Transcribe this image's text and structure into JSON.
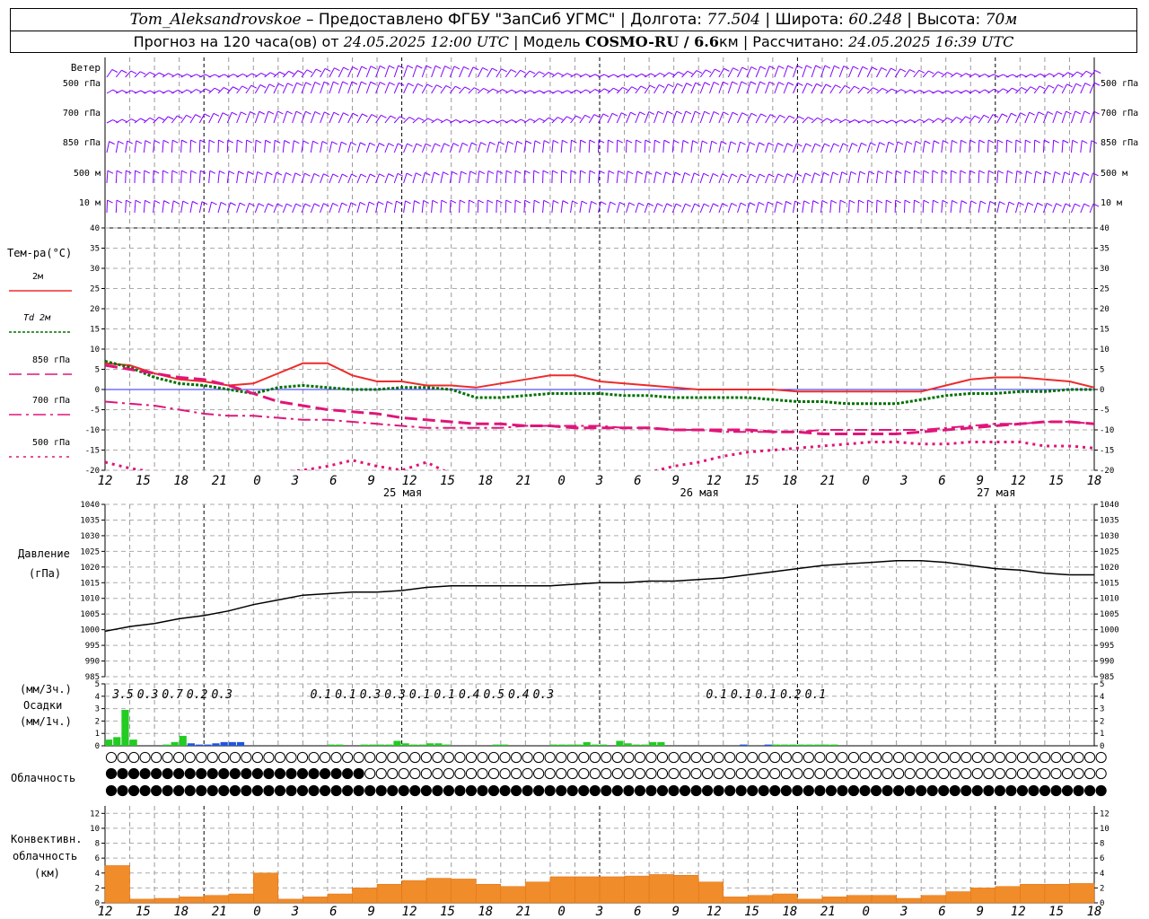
{
  "header": {
    "station": "Tom_Aleksandrovskoe",
    "provider": "– Предоставлено ФГБУ \"ЗапСиб УГМС\"",
    "lon_label": "| Долгота:",
    "lon": "77.504",
    "lat_label": "| Широта:",
    "lat": "60.248",
    "alt_label": "| Высота:",
    "alt": "70м",
    "forecast_label": "Прогноз на 120 часа(ов) от",
    "init_time": "24.05.2025 12:00 UTC",
    "model_label": "| Модель",
    "model": "COSMO-RU / 6.6",
    "model_unit": "км",
    "calc_label": "| Рассчитано:",
    "calc_time": "24.05.2025 16:39 UTC"
  },
  "wind_panel": {
    "title": "Ветер",
    "levels": [
      "500 гПа",
      "700 гПа",
      "850 гПа",
      "500 м",
      "10 м"
    ],
    "barb_color": "#8000ff"
  },
  "time_axis": {
    "hour_labels": [
      "12",
      "15",
      "18",
      "21",
      "0",
      "3",
      "6",
      "9",
      "12",
      "15",
      "18",
      "21",
      "0",
      "3",
      "6",
      "9",
      "12",
      "15",
      "18",
      "21",
      "0",
      "3",
      "6",
      "9",
      "12",
      "15",
      "18"
    ],
    "day_labels": [
      "25 мая",
      "26 мая",
      "27 мая"
    ]
  },
  "temp_panel": {
    "title": "Тем-ра(°C)",
    "legend": [
      {
        "label": "2м",
        "color": "#ee2b2b"
      },
      {
        "label": "Td 2м",
        "color": "#007000"
      },
      {
        "label": "850 гПа",
        "color": "#e0157a"
      },
      {
        "label": "700 гПа",
        "color": "#e0157a"
      },
      {
        "label": "500 гПа",
        "color": "#e0157a"
      }
    ],
    "y_ticks": [
      "40",
      "35",
      "30",
      "25",
      "20",
      "15",
      "10",
      "5",
      "0",
      "-5",
      "-10",
      "-15",
      "-20"
    ]
  },
  "pressure_panel": {
    "title": "Давление",
    "unit": "(гПа)",
    "y_ticks": [
      "1040",
      "1035",
      "1030",
      "1025",
      "1020",
      "1015",
      "1010",
      "1005",
      "1000",
      "995",
      "990",
      "985"
    ]
  },
  "precip_panel": {
    "unit3": "(мм/3ч.)",
    "title": "Осадки",
    "unit1": "(мм/1ч.)",
    "y_ticks": [
      "5",
      "4",
      "3",
      "2",
      "1",
      "0"
    ],
    "totals": [
      {
        "t": 0,
        "v": "3.5"
      },
      {
        "t": 3,
        "v": "0.3"
      },
      {
        "t": 6,
        "v": "0.7"
      },
      {
        "t": 9,
        "v": "0.2"
      },
      {
        "t": 12,
        "v": "0.3"
      },
      {
        "t": 24,
        "v": "0.1"
      },
      {
        "t": 27,
        "v": "0.1"
      },
      {
        "t": 30,
        "v": "0.3"
      },
      {
        "t": 33,
        "v": "0.3"
      },
      {
        "t": 36,
        "v": "0.1"
      },
      {
        "t": 39,
        "v": "0.1"
      },
      {
        "t": 42,
        "v": "0.4"
      },
      {
        "t": 45,
        "v": "0.5"
      },
      {
        "t": 48,
        "v": "0.4"
      },
      {
        "t": 51,
        "v": "0.3"
      },
      {
        "t": 72,
        "v": "0.1"
      },
      {
        "t": 75,
        "v": "0.1"
      },
      {
        "t": 78,
        "v": "0.1"
      },
      {
        "t": 81,
        "v": "0.2"
      },
      {
        "t": 84,
        "v": "0.1"
      }
    ]
  },
  "cloud_panel": {
    "title": "Облачность"
  },
  "conv_panel": {
    "title1": "Конвективн.",
    "title2": "облачность",
    "unit": "(км)",
    "y_ticks": [
      "12",
      "10",
      "8",
      "6",
      "4",
      "2",
      "0"
    ]
  },
  "chart_data": {
    "type": "line",
    "x_unit": "hours from 24.05.2025 12:00 UTC",
    "temperature": {
      "ylim": [
        -20,
        40
      ],
      "series": [
        {
          "name": "2м",
          "color": "#ee2b2b",
          "x": [
            0,
            3,
            6,
            9,
            12,
            15,
            18,
            21,
            24,
            27,
            30,
            33,
            36,
            39,
            42,
            45,
            48,
            51,
            54,
            57,
            60,
            63,
            66,
            69,
            72,
            75,
            78,
            81,
            84,
            87,
            90,
            93,
            96,
            99,
            102,
            105,
            108,
            111,
            114,
            117,
            120
          ],
          "values": [
            6.5,
            6,
            4,
            2.5,
            2,
            1,
            1.5,
            4,
            6.5,
            6.5,
            3.5,
            2,
            2,
            1,
            1,
            0.5,
            1.5,
            2.5,
            3.5,
            3.5,
            2,
            1.5,
            1,
            0.5,
            0,
            0,
            0,
            0,
            -0.5,
            -0.5,
            -0.5,
            -0.5,
            -0.5,
            -0.5,
            1,
            2.5,
            3,
            3,
            2.5,
            2,
            0.5
          ]
        },
        {
          "name": "Td 2м",
          "color": "#007000",
          "x": [
            0,
            3,
            6,
            9,
            12,
            15,
            18,
            21,
            24,
            27,
            30,
            33,
            36,
            39,
            42,
            45,
            48,
            51,
            54,
            57,
            60,
            63,
            66,
            69,
            72,
            75,
            78,
            81,
            84,
            87,
            90,
            93,
            96,
            99,
            102,
            105,
            108,
            111,
            114,
            117,
            120
          ],
          "values": [
            7,
            5.5,
            3,
            1.5,
            1,
            0,
            -1,
            0.5,
            1,
            0.5,
            0,
            0,
            0.5,
            0.5,
            0,
            -2,
            -2,
            -1.5,
            -1,
            -1,
            -1,
            -1.5,
            -1.5,
            -2,
            -2,
            -2,
            -2,
            -2.5,
            -3,
            -3,
            -3.5,
            -3.5,
            -3.5,
            -2.5,
            -1.5,
            -1,
            -1,
            -0.5,
            -0.5,
            0,
            0
          ]
        },
        {
          "name": "850 гПа",
          "color": "#e0157a",
          "x": [
            0,
            3,
            6,
            9,
            12,
            15,
            18,
            21,
            24,
            27,
            30,
            33,
            36,
            39,
            42,
            45,
            48,
            51,
            54,
            57,
            60,
            63,
            66,
            69,
            72,
            75,
            78,
            81,
            84,
            87,
            90,
            93,
            96,
            99,
            102,
            105,
            108,
            111,
            114,
            117,
            120
          ],
          "values": [
            6,
            5,
            4,
            3,
            2.5,
            1,
            -1,
            -3,
            -4,
            -5,
            -5.5,
            -6,
            -7,
            -7.5,
            -8,
            -8.5,
            -8.5,
            -9,
            -9,
            -9.5,
            -9.5,
            -9.5,
            -9.5,
            -10,
            -10,
            -10,
            -10,
            -10.5,
            -10.5,
            -11,
            -11,
            -11,
            -11,
            -10.5,
            -10,
            -9.5,
            -9,
            -8.5,
            -8,
            -8,
            -8.5
          ]
        },
        {
          "name": "700 гПа",
          "color": "#e0157a",
          "x": [
            0,
            3,
            6,
            9,
            12,
            15,
            18,
            21,
            24,
            27,
            30,
            33,
            36,
            39,
            42,
            45,
            48,
            51,
            54,
            57,
            60,
            63,
            66,
            69,
            72,
            75,
            78,
            81,
            84,
            87,
            90,
            93,
            96,
            99,
            102,
            105,
            108,
            111,
            114,
            117,
            120
          ],
          "values": [
            -3,
            -3.5,
            -4,
            -5,
            -6,
            -6.5,
            -6.5,
            -7,
            -7.5,
            -7.5,
            -8,
            -8.5,
            -9,
            -9.5,
            -9.5,
            -9.5,
            -9.5,
            -9,
            -9,
            -9,
            -9,
            -9.5,
            -9.5,
            -10,
            -10,
            -10.5,
            -10.5,
            -10.5,
            -10.5,
            -10,
            -10,
            -10,
            -10,
            -10,
            -9.5,
            -9,
            -8.5,
            -8.5,
            -8,
            -8,
            -8.5
          ]
        },
        {
          "name": "500 гПа",
          "color": "#e0157a",
          "x": [
            0,
            3,
            6,
            9,
            12,
            15,
            18,
            21,
            24,
            27,
            30,
            33,
            36,
            39,
            42,
            45,
            48,
            51,
            54,
            57,
            60,
            63,
            66,
            69,
            72,
            75,
            78,
            81,
            84,
            87,
            90,
            93,
            96,
            99,
            102,
            105,
            108,
            111,
            114,
            117,
            120
          ],
          "values": [
            -18,
            -19.5,
            -20.5,
            -21,
            -21.5,
            -22,
            -21,
            -20.5,
            -20,
            -19,
            -17.5,
            -19,
            -20,
            -18,
            -21,
            -22,
            -20.5,
            -21,
            -22,
            -22,
            -22.5,
            -22,
            -20.5,
            -19,
            -18,
            -16.5,
            -15.5,
            -15,
            -14.5,
            -14,
            -13.5,
            -13,
            -13,
            -13.5,
            -13.5,
            -13,
            -13,
            -13,
            -14,
            -14,
            -14.5
          ]
        }
      ]
    },
    "pressure": {
      "ylim": [
        985,
        1040
      ],
      "x": [
        0,
        3,
        6,
        9,
        12,
        15,
        18,
        21,
        24,
        27,
        30,
        33,
        36,
        39,
        42,
        45,
        48,
        51,
        54,
        57,
        60,
        63,
        66,
        69,
        72,
        75,
        78,
        81,
        84,
        87,
        90,
        93,
        96,
        99,
        102,
        105,
        108,
        111,
        114,
        117,
        120
      ],
      "values": [
        999.5,
        1001,
        1002,
        1003.5,
        1004.5,
        1006,
        1008,
        1009.5,
        1011,
        1011.5,
        1012,
        1012,
        1012.5,
        1013.5,
        1014,
        1014,
        1014,
        1014,
        1014,
        1014.5,
        1015,
        1015,
        1015.5,
        1015.5,
        1016,
        1016.5,
        1017.5,
        1018.5,
        1019.5,
        1020.5,
        1021,
        1021.5,
        1022,
        1022,
        1021.5,
        1020.5,
        1019.5,
        1019,
        1018,
        1017.5,
        1017.5
      ]
    },
    "precip_hourly": {
      "ylim": [
        0,
        5
      ],
      "x": [
        0,
        1,
        2,
        3,
        4,
        5,
        6,
        7,
        8,
        9,
        10,
        11,
        12,
        13,
        14,
        15,
        16,
        17,
        18,
        19,
        20,
        21,
        22,
        23,
        24,
        25,
        26,
        27,
        28,
        29,
        30,
        31,
        32,
        33,
        34,
        35,
        36,
        37,
        38,
        39,
        40,
        41,
        42,
        43,
        44,
        45,
        46,
        47,
        48,
        49,
        50,
        51,
        52,
        53,
        54,
        55,
        56,
        57,
        58,
        59,
        60,
        61,
        62,
        63,
        64,
        65,
        66,
        67,
        68,
        69,
        70,
        71,
        72,
        73,
        74,
        75,
        76,
        77,
        78,
        79,
        80,
        81,
        82,
        83,
        84,
        85,
        86,
        87,
        88
      ],
      "values": [
        0.5,
        0.7,
        2.9,
        0.5,
        0,
        0,
        0,
        0.1,
        0.3,
        0.8,
        0.2,
        0.1,
        0.1,
        0.2,
        0.3,
        0.3,
        0.3,
        0,
        0,
        0,
        0,
        0,
        0,
        0,
        0,
        0,
        0,
        0.1,
        0.1,
        0,
        0,
        0.1,
        0.1,
        0.1,
        0.1,
        0.4,
        0.2,
        0.1,
        0.1,
        0.2,
        0.2,
        0.1,
        0,
        0,
        0,
        0,
        0,
        0.1,
        0.1,
        0,
        0,
        0,
        0,
        0,
        0.1,
        0.1,
        0.1,
        0.1,
        0.3,
        0.1,
        0.1,
        0,
        0.4,
        0.2,
        0.1,
        0.1,
        0.3,
        0.3,
        0,
        0,
        0,
        0,
        0,
        0,
        0,
        0,
        0,
        0.1,
        0,
        0,
        0.1,
        0.1,
        0.1,
        0.1,
        0.1,
        0.1,
        0.1,
        0.1,
        0.1
      ],
      "colors": [
        "#22cc22",
        "#2255dd"
      ]
    },
    "cloud_rows": [
      [
        0,
        0,
        0,
        0,
        0,
        0,
        0,
        0,
        0,
        0,
        0,
        0,
        0,
        0,
        0,
        0,
        0,
        0,
        0,
        0,
        0,
        0,
        0,
        0,
        0,
        0,
        0,
        0,
        0,
        0,
        0,
        0,
        0,
        0,
        0,
        0,
        0,
        0,
        0,
        0,
        0,
        0,
        0,
        0,
        0,
        0,
        0,
        0,
        0,
        0,
        0,
        0,
        0,
        0,
        0,
        0,
        0,
        0,
        0,
        0,
        0,
        0,
        0,
        0,
        0,
        0,
        0,
        0,
        0,
        0,
        0,
        0,
        0,
        0,
        0,
        0,
        0,
        0,
        0,
        0,
        0,
        0,
        0,
        0,
        0,
        0,
        0,
        0,
        0
      ],
      [
        4,
        4,
        4,
        4,
        4,
        4,
        4,
        4,
        4,
        4,
        4,
        4,
        4,
        4,
        4,
        4,
        4,
        4,
        4,
        4,
        4,
        4,
        4,
        0,
        0,
        0,
        0,
        0,
        0,
        0,
        0,
        0,
        0,
        0,
        0,
        0,
        0,
        0,
        0,
        0,
        0,
        0,
        0,
        0,
        0,
        0,
        0,
        0,
        0,
        0,
        0,
        0,
        0,
        0,
        0,
        0,
        0,
        0,
        0,
        0,
        0,
        0,
        0,
        0,
        0,
        0,
        0,
        0,
        0,
        0,
        0,
        0,
        0,
        0,
        0,
        0,
        0,
        0,
        0,
        0,
        0,
        0,
        0,
        0,
        0,
        0,
        0,
        0,
        0
      ],
      [
        4,
        4,
        4,
        4,
        4,
        4,
        4,
        4,
        4,
        4,
        4,
        4,
        4,
        4,
        4,
        4,
        4,
        4,
        4,
        4,
        4,
        4,
        4,
        4,
        4,
        4,
        4,
        4,
        4,
        4,
        4,
        4,
        4,
        4,
        4,
        4,
        4,
        4,
        4,
        4,
        4,
        4,
        4,
        4,
        4,
        4,
        4,
        4,
        4,
        4,
        4,
        4,
        4,
        4,
        4,
        4,
        4,
        4,
        4,
        4,
        4,
        4,
        4,
        4,
        4,
        4,
        4,
        4,
        4,
        4,
        4,
        4,
        4,
        4,
        4,
        4,
        4,
        4,
        4,
        4,
        4,
        4,
        4,
        4,
        4,
        4,
        4,
        4,
        4
      ]
    ],
    "convective_cloud": {
      "ylim": [
        0,
        13
      ],
      "x": [
        0,
        3,
        6,
        9,
        12,
        15,
        18,
        21,
        24,
        27,
        30,
        33,
        36,
        39,
        42,
        45,
        48,
        51,
        54,
        57,
        60,
        63,
        66,
        69,
        72,
        75,
        78,
        81,
        84,
        87,
        90,
        93,
        96,
        99,
        102,
        105,
        108,
        111,
        114,
        117
      ],
      "base": [
        0,
        0,
        0,
        0,
        0,
        0,
        0,
        0,
        0,
        0,
        0,
        0,
        0,
        0,
        0,
        0,
        0,
        0,
        0,
        0,
        0,
        0,
        0,
        0,
        0,
        0,
        0,
        0,
        0,
        0,
        0,
        0,
        0,
        0,
        0,
        0,
        0,
        0,
        0,
        0
      ],
      "top": [
        5,
        0.5,
        0.6,
        0.8,
        1,
        1.2,
        4,
        0.5,
        0.8,
        1.2,
        2,
        2.5,
        3,
        3.3,
        3.2,
        2.5,
        2.2,
        2.8,
        3.5,
        3.5,
        3.5,
        3.6,
        3.8,
        3.7,
        2.8,
        0.8,
        1,
        1.2,
        0.5,
        0.8,
        1,
        1,
        0.6,
        1,
        1.5,
        2,
        2.2,
        2.5,
        2.5,
        2.6
      ]
    }
  }
}
